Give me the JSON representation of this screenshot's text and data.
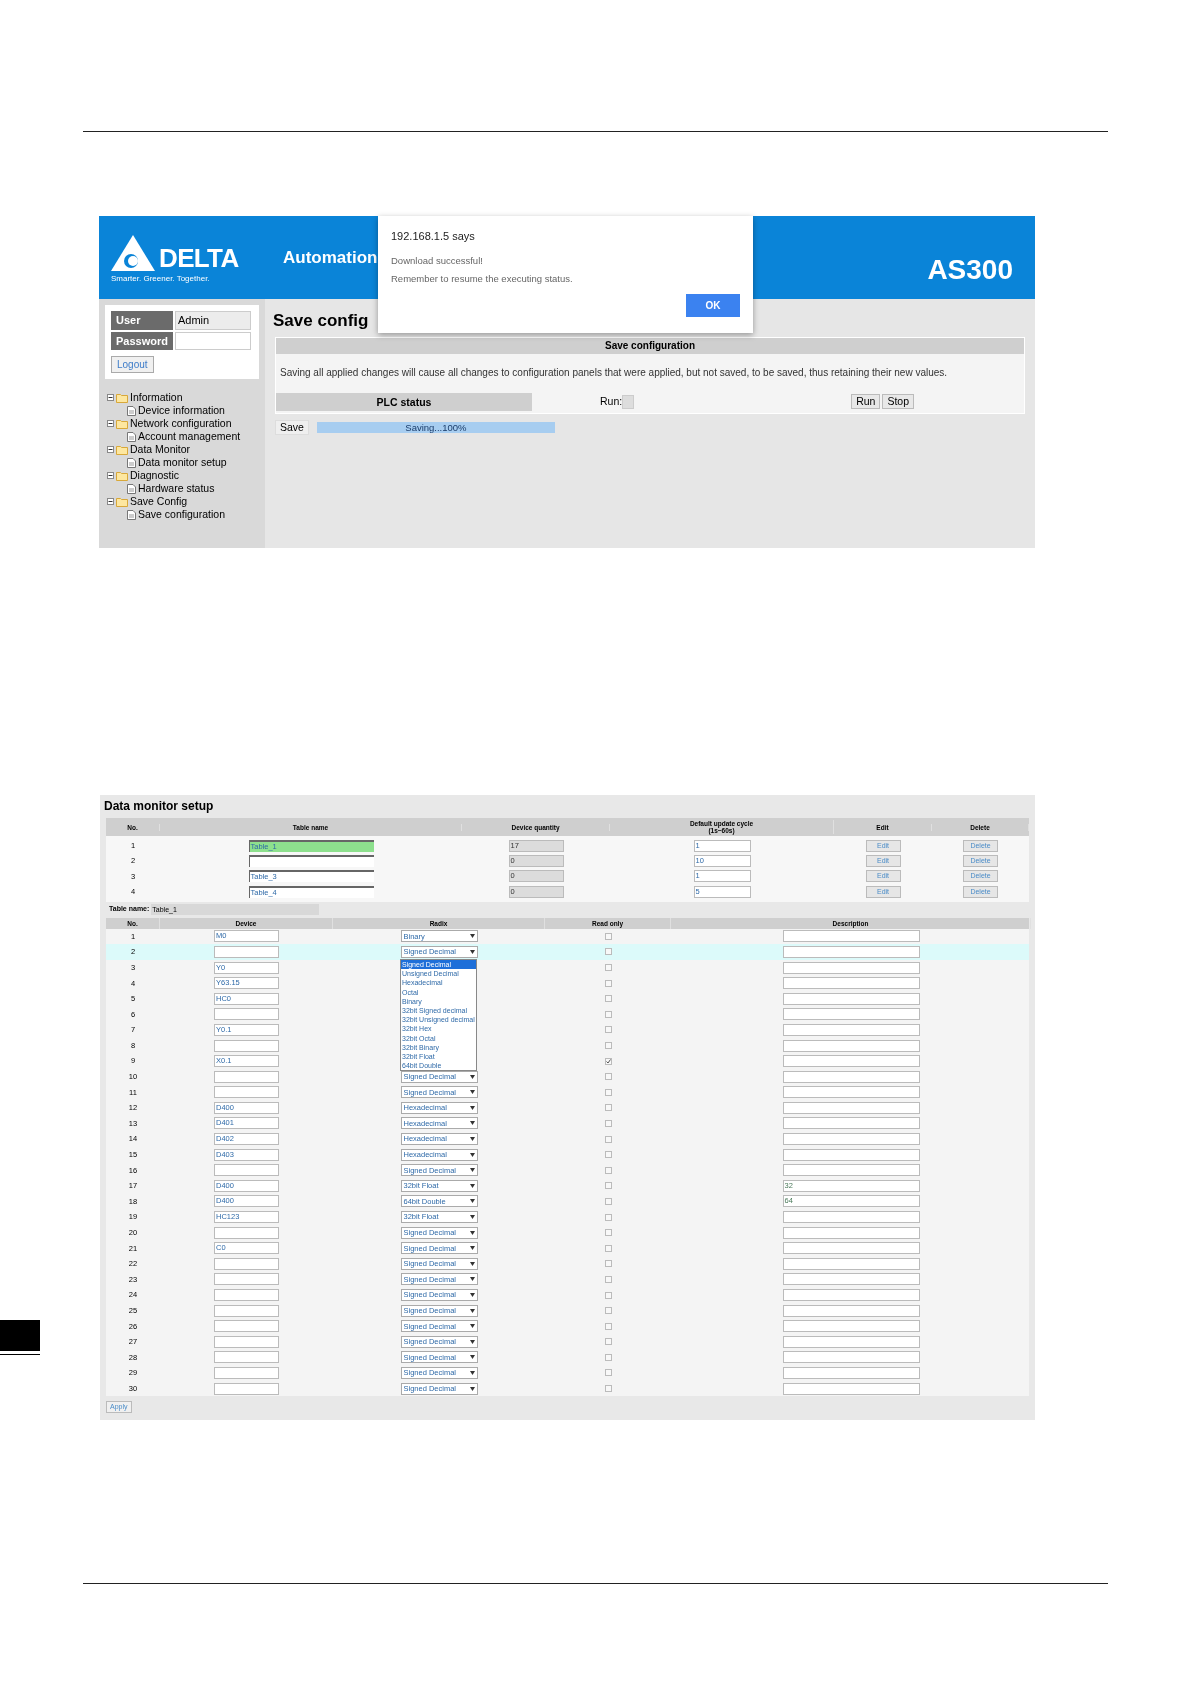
{
  "screen_1": {
    "header": {
      "logo": "DELTA",
      "tagline": "Smarter. Greener. Together.",
      "section": "Automation",
      "model": "AS300"
    },
    "login": {
      "user_label": "User",
      "user_value": "Admin",
      "password_label": "Password",
      "logout": "Logout"
    },
    "tree": [
      {
        "label": "Information",
        "expanded": true,
        "children": [
          {
            "label": "Device information"
          }
        ]
      },
      {
        "label": "Network configuration",
        "expanded": true,
        "children": [
          {
            "label": "Account management"
          }
        ]
      },
      {
        "label": "Data Monitor",
        "expanded": true,
        "children": [
          {
            "label": "Data monitor setup"
          }
        ]
      },
      {
        "label": "Diagnostic",
        "expanded": true,
        "children": [
          {
            "label": "Hardware status"
          }
        ]
      },
      {
        "label": "Save Config",
        "expanded": true,
        "children": [
          {
            "label": "Save configuration"
          }
        ]
      }
    ],
    "title": "Save config",
    "panel": {
      "header": "Save configuration",
      "message": "Saving all applied changes will cause all changes to configuration panels that were applied, but not saved, to be saved, thus retaining their new values.",
      "plc_status": "PLC status",
      "run_label": "Run:",
      "buttons": [
        "Run",
        "Stop"
      ]
    },
    "save": {
      "button": "Save",
      "progress": {
        "label": "Saving...100%",
        "level": 1
      }
    },
    "dialog": {
      "title": "192.168.1.5 says",
      "lines": [
        "Download successful!",
        "Remember to resume the executing status."
      ],
      "ok": "OK"
    }
  },
  "screen_2": {
    "title": "Data monitor setup",
    "tables": {
      "columns": [
        "No.",
        "Table name",
        "Device quantity",
        "Default update cycle\n(1s~60s)",
        "Edit",
        "Delete"
      ],
      "rows": [
        {
          "no": "1",
          "name": "Table_1",
          "selected": true,
          "quantity": "17",
          "cycle": "1",
          "edit": "Edit",
          "delete": "Delete"
        },
        {
          "no": "2",
          "selected": false,
          "quantity": "0",
          "cycle": "10",
          "edit": "Edit",
          "delete": "Delete"
        },
        {
          "no": "3",
          "name": "Table_3",
          "selected": false,
          "quantity": "0",
          "cycle": "1",
          "edit": "Edit",
          "delete": "Delete"
        },
        {
          "no": "4",
          "name": "Table_4",
          "selected": false,
          "quantity": "0",
          "cycle": "5",
          "edit": "Edit",
          "delete": "Delete"
        }
      ]
    },
    "table_name": {
      "label": "Table name:",
      "value": "Table_1"
    },
    "devices": {
      "columns": [
        "No.",
        "Device",
        "Radix",
        "Read only",
        "Description"
      ],
      "rows": [
        {
          "no": "1",
          "device": "M0",
          "radix": "Binary",
          "read_only": false,
          "selected": false
        },
        {
          "no": "2",
          "radix": "Signed Decimal",
          "read_only": false,
          "selected": true
        },
        {
          "no": "3",
          "device": "Y0",
          "read_only": false,
          "selected": false
        },
        {
          "no": "4",
          "device": "Y63.15",
          "read_only": false,
          "selected": false
        },
        {
          "no": "5",
          "device": "HC0",
          "read_only": false,
          "selected": false
        },
        {
          "no": "6",
          "read_only": false,
          "selected": false
        },
        {
          "no": "7",
          "device": "Y0.1",
          "read_only": false,
          "selected": false
        },
        {
          "no": "8",
          "read_only": false,
          "selected": false
        },
        {
          "no": "9",
          "device": "X0.1",
          "read_only": true,
          "selected": false
        },
        {
          "no": "10",
          "radix": "Signed Decimal",
          "read_only": false,
          "selected": false
        },
        {
          "no": "11",
          "radix": "Signed Decimal",
          "read_only": false,
          "selected": false
        },
        {
          "no": "12",
          "device": "D400",
          "radix": "Hexadecimal",
          "read_only": false,
          "selected": false
        },
        {
          "no": "13",
          "device": "D401",
          "radix": "Hexadecimal",
          "read_only": false,
          "selected": false
        },
        {
          "no": "14",
          "device": "D402",
          "radix": "Hexadecimal",
          "read_only": false,
          "selected": false
        },
        {
          "no": "15",
          "device": "D403",
          "radix": "Hexadecimal",
          "read_only": false,
          "selected": false
        },
        {
          "no": "16",
          "radix": "Signed Decimal",
          "read_only": false,
          "selected": false
        },
        {
          "no": "17",
          "device": "D400",
          "radix": "32bit Float",
          "read_only": false,
          "description": "32",
          "selected": false
        },
        {
          "no": "18",
          "device": "D400",
          "radix": "64bit Double",
          "read_only": false,
          "description": "64",
          "selected": false
        },
        {
          "no": "19",
          "device": "HC123",
          "radix": "32bit Float",
          "read_only": false,
          "selected": false
        },
        {
          "no": "20",
          "radix": "Signed Decimal",
          "read_only": false,
          "selected": false
        },
        {
          "no": "21",
          "device": "C0",
          "radix": "Signed Decimal",
          "read_only": false,
          "selected": false
        },
        {
          "no": "22",
          "radix": "Signed Decimal",
          "read_only": false,
          "selected": false
        },
        {
          "no": "23",
          "radix": "Signed Decimal",
          "read_only": false,
          "selected": false
        },
        {
          "no": "24",
          "radix": "Signed Decimal",
          "read_only": false,
          "selected": false
        },
        {
          "no": "25",
          "radix": "Signed Decimal",
          "read_only": false,
          "selected": false
        },
        {
          "no": "26",
          "radix": "Signed Decimal",
          "read_only": false,
          "selected": false
        },
        {
          "no": "27",
          "radix": "Signed Decimal",
          "read_only": false,
          "selected": false
        },
        {
          "no": "28",
          "radix": "Signed Decimal",
          "read_only": false,
          "selected": false
        },
        {
          "no": "29",
          "radix": "Signed Decimal",
          "read_only": false,
          "selected": false
        },
        {
          "no": "30",
          "radix": "Signed Decimal",
          "read_only": false,
          "selected": false
        }
      ]
    },
    "radix_options": [
      {
        "label": "Signed Decimal",
        "selected": true
      },
      {
        "label": "Unsigned Decimal",
        "selected": false
      },
      {
        "label": "Hexadecimal",
        "selected": false
      },
      {
        "label": "Octal",
        "selected": false
      },
      {
        "label": "Binary",
        "selected": false
      },
      {
        "label": "32bit Signed decimal",
        "selected": false
      },
      {
        "label": "32bit Unsigned decimal",
        "selected": false
      },
      {
        "label": "32bit Hex",
        "selected": false
      },
      {
        "label": "32bit Octal",
        "selected": false
      },
      {
        "label": "32bit Binary",
        "selected": false
      },
      {
        "label": "32bit Float",
        "selected": false
      },
      {
        "label": "64bit Double",
        "selected": false
      }
    ],
    "apply": "Apply"
  }
}
